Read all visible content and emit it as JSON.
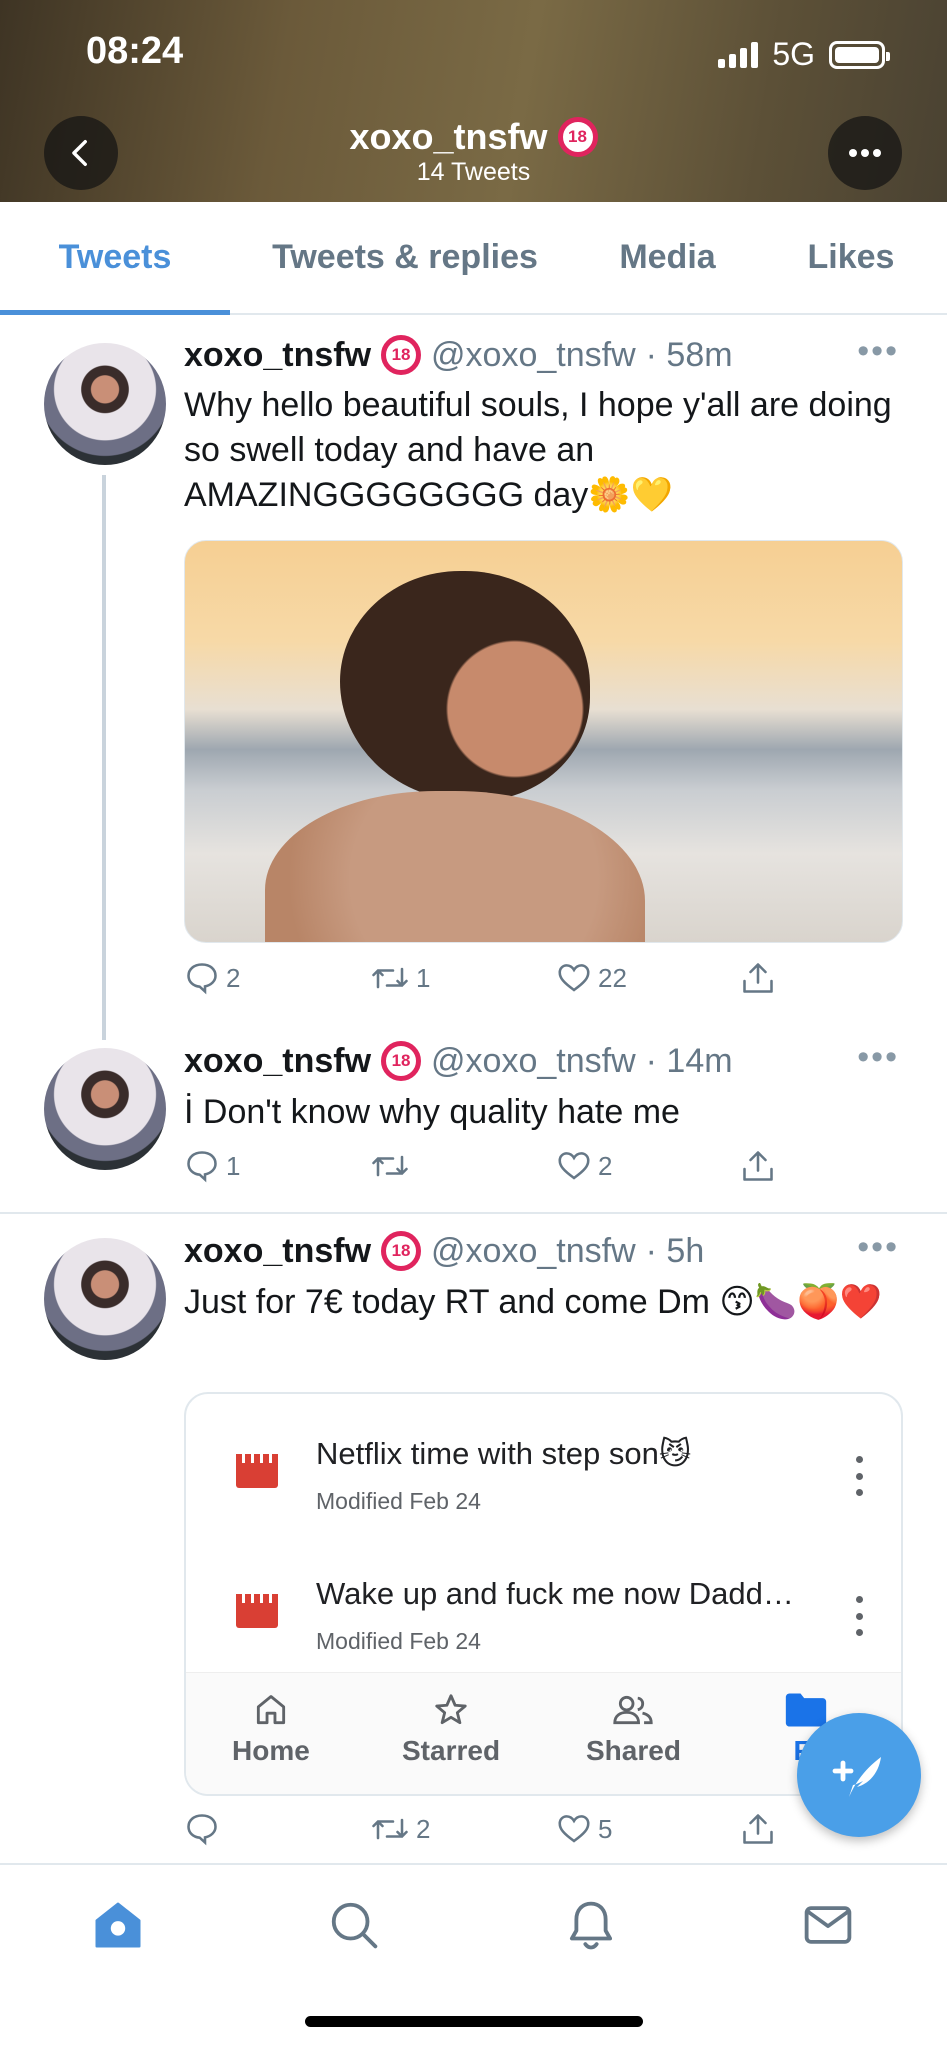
{
  "status_bar": {
    "time": "08:24",
    "network": "5G"
  },
  "header": {
    "name": "xoxo_tnsfw",
    "tweet_count": "14 Tweets",
    "badge": "18"
  },
  "tabs": [
    {
      "label": "Tweets",
      "active": true
    },
    {
      "label": "Tweets & replies",
      "active": false
    },
    {
      "label": "Media",
      "active": false
    },
    {
      "label": "Likes",
      "active": false
    }
  ],
  "tweets": [
    {
      "name": "xoxo_tnsfw",
      "badge": "18",
      "handle": "@xoxo_tnsfw",
      "time": "· 58m",
      "text": "Why hello beautiful souls, I hope y'all are doing so swell today and have an AMAZINGGGGGGGG day🌼💛",
      "replies": "2",
      "retweets": "1",
      "likes": "22"
    },
    {
      "name": "xoxo_tnsfw",
      "badge": "18",
      "handle": "@xoxo_tnsfw",
      "time": "· 14m",
      "text": "İ Don't know why quality hate me",
      "replies": "1",
      "retweets": "",
      "likes": "2"
    },
    {
      "name": "xoxo_tnsfw",
      "badge": "18",
      "handle": "@xoxo_tnsfw",
      "time": "· 5h",
      "text": "Just for 7€ today RT and come Dm 😙🍆🍑❤️",
      "replies": "",
      "retweets": "2",
      "likes": "5",
      "drive_card": {
        "files": [
          {
            "name": "Netflix time with step son😼",
            "meta": "Modified Feb 24"
          },
          {
            "name": "Wake up and fuck me now Dadd…",
            "meta": "Modified Feb 24"
          }
        ],
        "nav": [
          "Home",
          "Starred",
          "Shared",
          "Fi"
        ]
      }
    }
  ],
  "icons": {
    "reply": "reply-icon",
    "retweet": "retweet-icon",
    "like": "like-icon",
    "share": "share-icon",
    "compose": "compose-icon",
    "home": "home-icon",
    "search": "search-icon",
    "notifications": "bell-icon",
    "messages": "mail-icon"
  },
  "colors": {
    "accent": "#4a90d9",
    "badge": "#e0245e",
    "fab": "#4a9fe8",
    "drive_file": "#d93f34",
    "drive_folder": "#1a73e8"
  }
}
